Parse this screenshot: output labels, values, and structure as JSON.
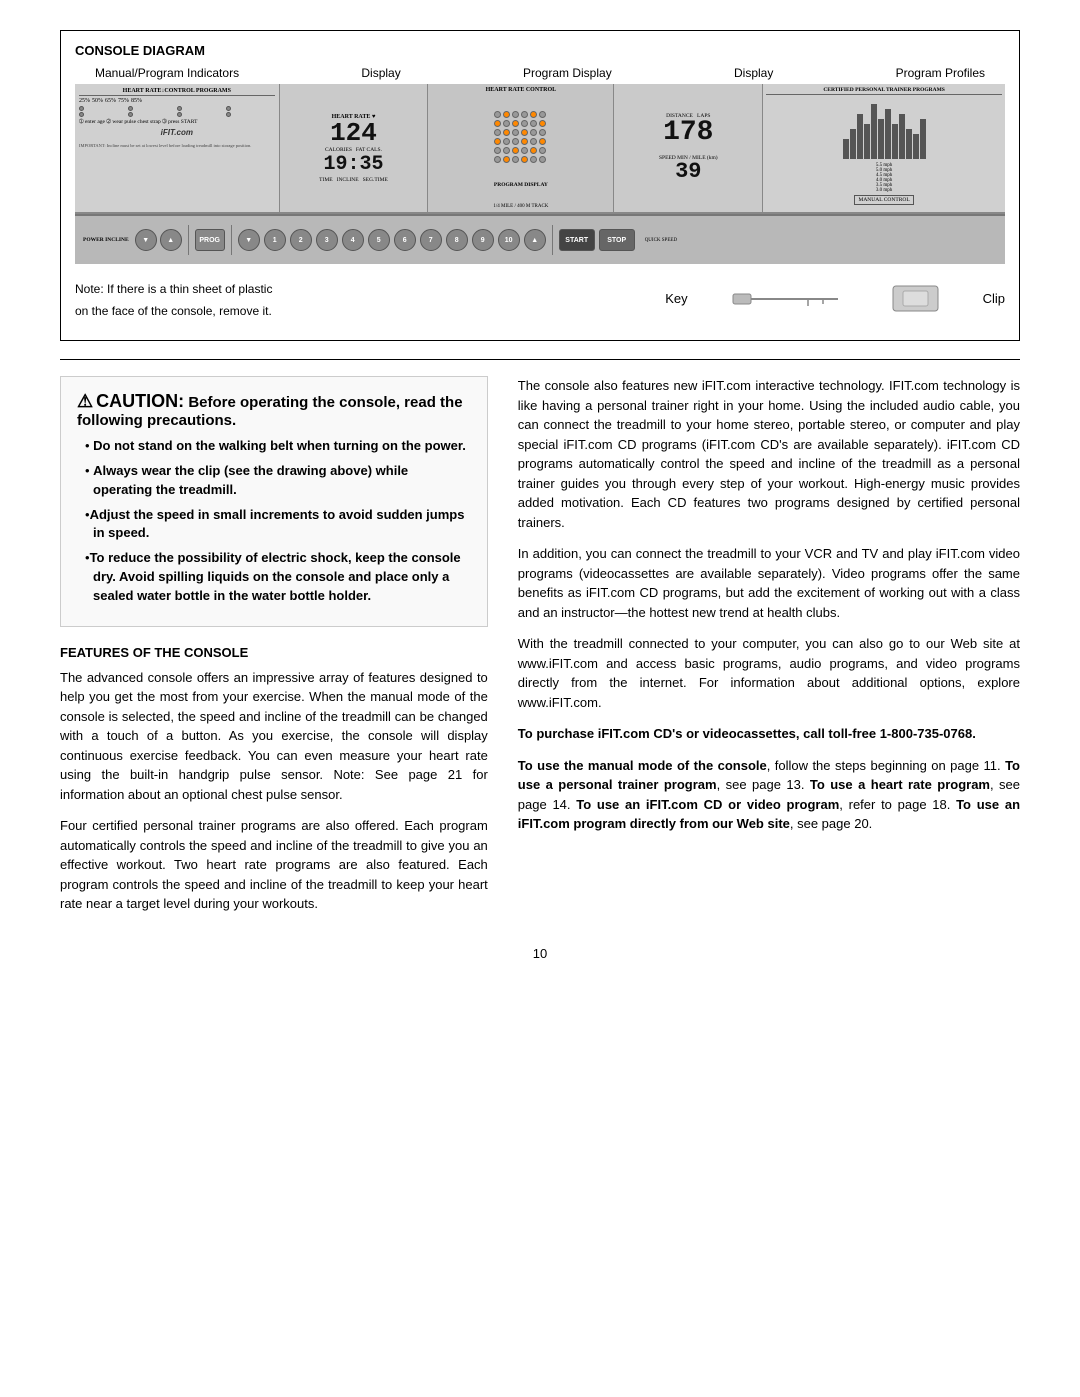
{
  "page": {
    "title": "Console Diagram Page 10"
  },
  "console_diagram": {
    "title": "CONSOLE DIAGRAM",
    "labels": {
      "manual_program": "Manual/Program Indicators",
      "display": "Display",
      "program_display": "Program Display",
      "display2": "Display",
      "program_profiles": "Program Profiles"
    },
    "hr_display": "124",
    "time_display": "19:35",
    "distance_display": "178",
    "speed_display": "39",
    "calories_label": "CALORIES",
    "fat_cals_label": "FAT CALS.",
    "distance_label": "DISTANCE",
    "laps_label": "LAPS",
    "time_label": "TIME",
    "incline_label": "INCLINE",
    "seg_time_label": "SEG.TIME",
    "track_label": "1/4 MILE / 400 M TRACK",
    "speed_min_label": "SPEED  MIN / MILE (km)",
    "program_display_label": "PROGRAM DISPLAY",
    "quick_speed_label": "QUICK SPEED",
    "manual_control_label": "MANUAL CONTROL",
    "power_incline_label": "POWER INCLINE",
    "heart_rate_label": "HEART RATE ♥",
    "heart_rate_control_label": "HEART RATE CONTROL",
    "certified_label": "CERTIFIED PERSONAL TRAINER PROGRAMS",
    "ifit_label": "iFIT.com",
    "start_btn": "START",
    "stop_btn": "STOP",
    "program_btn": "PROGRAM",
    "buttons": [
      "1",
      "2",
      "3",
      "4",
      "5",
      "6",
      "7",
      "8",
      "9",
      "10"
    ]
  },
  "note": {
    "line1": "Note: If there is a thin sheet of plastic",
    "line2": "on the face of the console, remove it.",
    "key_label": "Key",
    "clip_label": "Clip"
  },
  "caution": {
    "icon": "⚠",
    "word": "CAUTION:",
    "subtitle": "Before operating the console, read the following precautions.",
    "bullets": [
      "Do not stand on the walking belt when turning on the power.",
      "Always wear the clip (see the drawing above) while operating the treadmill.",
      "Adjust the speed in small increments to avoid sudden jumps in speed.",
      "To reduce the possibility of electric shock, keep the console dry. Avoid spilling liquids on the console and place only a sealed water bottle in the water bottle holder."
    ]
  },
  "features": {
    "title": "FEATURES OF THE CONSOLE",
    "paragraphs": [
      "The advanced console offers an impressive array of features designed to help you get the most from your exercise. When the manual mode of the console is selected, the speed and incline of the treadmill can be changed with a touch of a button. As you exercise, the console will display continuous exercise feedback. You can even measure your heart rate using the built-in handgrip pulse sensor. Note: See page 21 for information about an optional chest pulse sensor.",
      "Four certified personal trainer programs are also offered. Each program automatically controls the speed and incline of the treadmill to give you an effective workout. Two heart rate programs are also featured. Each program controls the speed and incline of the treadmill to keep your heart rate near a target level during your workouts."
    ]
  },
  "right_column": {
    "paragraphs": [
      "The console also features new iFIT.com interactive technology. IFIT.com technology is like having a personal trainer right in your home. Using the included audio cable, you can connect the treadmill to your home stereo, portable stereo, or computer and play special iFIT.com CD programs (iFIT.com CD's are available separately). iFIT.com CD programs automatically control the speed and incline of the treadmill as a personal trainer guides you through every step of your workout. High-energy music provides added motivation. Each CD features two programs designed by certified personal trainers.",
      "In addition, you can connect the treadmill to your VCR and TV and play iFIT.com video programs (videocassettes are available separately). Video programs offer the same benefits as iFIT.com CD programs, but add the excitement of working out with a class and an instructor—the hottest new trend at health clubs.",
      "With the treadmill connected to your computer, you can also go to our Web site at www.iFIT.com and access basic programs, audio programs, and video programs directly from the internet. For information about additional options, explore www.iFIT.com.",
      "To purchase iFIT.com CD's or videocassettes, call toll-free 1-800-735-0768.",
      "To use the manual mode of the console, follow the steps beginning on page 11. To use a personal trainer program, see page 13. To use a heart rate program, see page 14. To use an iFIT.com CD or video program, refer to page 18. To use an iFIT.com program directly from our Web site, see page 20."
    ]
  },
  "page_number": "10"
}
